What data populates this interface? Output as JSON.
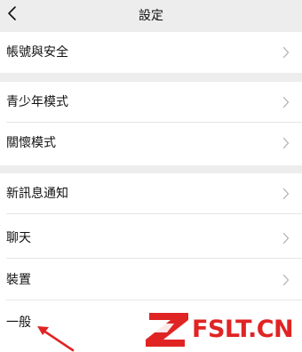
{
  "nav": {
    "title": "設定",
    "back_icon": "chevron-left-icon"
  },
  "groups": [
    {
      "items": [
        {
          "label": "帳號與安全",
          "icon": "chevron-right-icon"
        }
      ]
    },
    {
      "items": [
        {
          "label": "青少年模式",
          "icon": "chevron-right-icon"
        },
        {
          "label": "關懷模式",
          "icon": "chevron-right-icon"
        }
      ]
    },
    {
      "items": [
        {
          "label": "新訊息通知",
          "icon": "chevron-right-icon"
        },
        {
          "label": "聊天",
          "icon": "chevron-right-icon"
        },
        {
          "label": "裝置",
          "icon": "chevron-right-icon"
        },
        {
          "label": "一般"
        }
      ]
    }
  ],
  "watermark": {
    "text": "FSLT.CN",
    "color": "#e02424"
  },
  "colors": {
    "background": "#ededed",
    "row_background": "#ffffff",
    "chevron": "#b2b2b2",
    "accent": "#e02424"
  }
}
